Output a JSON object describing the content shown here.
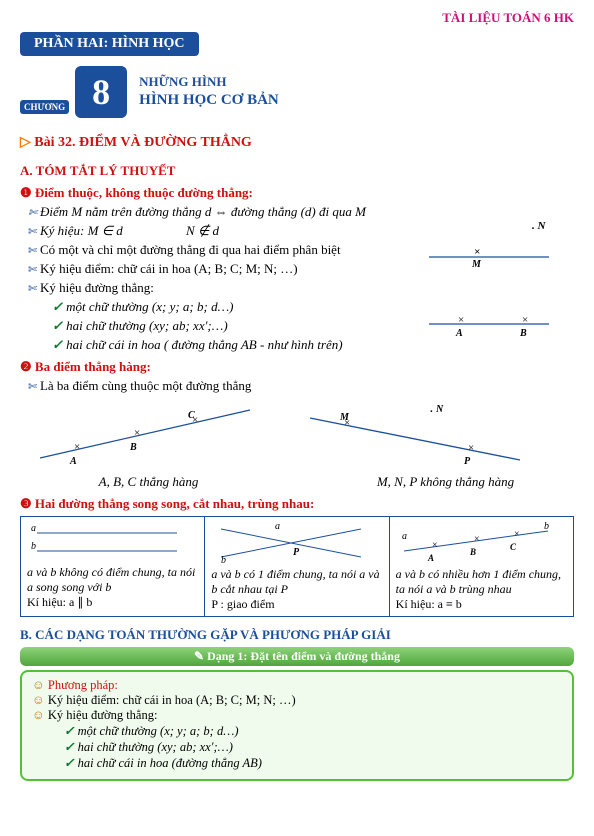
{
  "banner": "TÀI LIỆU TOÁN 6 HK",
  "part": "PHẦN HAI:  HÌNH HỌC",
  "chapter": {
    "word": "CHƯƠNG",
    "number": "8",
    "super": "NHỮNG HÌNH",
    "main": "HÌNH HỌC CƠ BẢN"
  },
  "lesson": "Bài 32. ĐIỂM VÀ ĐƯỜNG THẲNG",
  "sectionA": "A. TÓM TẮT LÝ THUYẾT",
  "sub1": "❶ Điểm thuộc, không thuộc đường thẳng:",
  "l1": "Điểm M nằm trên đường thẳng d  ⇔  đường thẳng (d) đi qua M",
  "l2a": "Ký hiệu:  M ∈ d",
  "l2b": "N ∉ d",
  "l3": "Có một và chỉ một đường thẳng đi qua hai điểm phân biệt",
  "l4": "Ký hiệu điểm: chữ cái in hoa (A; B; C; M; N; …)",
  "l5": "Ký hiệu đường thẳng:",
  "l5a": "một chữ thường (x; y; a; b; d…)",
  "l5b": "hai chữ thường (xy; ab; xx′;…)",
  "l5c": "hai chữ cái in hoa ( đường thẳng  AB  - như hình trên)",
  "sub2": "❷ Ba điểm thẳng hàng:",
  "l6": "Là ba điểm cùng thuộc một đường thẳng",
  "cap1": "A, B, C  thẳng hàng",
  "cap2": "M, N, P  không thẳng hàng",
  "sub3": "❸ Hai đường thẳng song song, cắt nhau, trùng nhau:",
  "case1": {
    "text": "a và b không có điểm chung, ta nói a song song với b",
    "ki": "Kí hiệu: a ∥ b"
  },
  "case2": {
    "text": "a và b có 1 điểm chung, ta nói a và b cắt nhau tại P",
    "ki": "P : giao điểm"
  },
  "case3": {
    "text": "a và b có nhiều hơn 1 điểm chung, ta nói a và b trùng nhau",
    "ki": "Kí hiệu: a ≡ b"
  },
  "sectionB": "B. CÁC DẠNG TOÁN THƯỜNG GẶP VÀ PHƯƠNG PHÁP GIẢI",
  "greenBar": "Dạng 1: Đặt tên điểm và đường thẳng",
  "method": {
    "pp": "Phương pháp:",
    "m1": "Ký hiệu điểm: chữ cái in hoa (A; B; C; M; N; …)",
    "m2": "Ký hiệu đường thẳng:",
    "m2a": "một chữ thường (x; y; a; b; d…)",
    "m2b": "hai chữ thường (xy; ab; xx′;…)",
    "m2c": "hai chữ cái in hoa (đường thẳng  AB)"
  }
}
